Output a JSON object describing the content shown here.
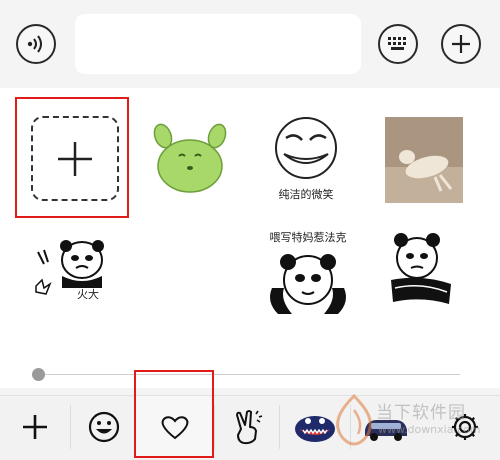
{
  "input_bar": {
    "voice_icon": "voice-waves-icon",
    "message_value": "",
    "keyboard_icon": "keyboard-icon",
    "add_icon": "plus-icon"
  },
  "sticker_panel": {
    "add_tile_icon": "plus-icon",
    "stickers": [
      {
        "icon": "green-blob-sticker",
        "caption": ""
      },
      {
        "icon": "grin-face-sticker",
        "caption": "纯洁的微笑"
      },
      {
        "icon": "dog-photo-sticker",
        "caption": ""
      },
      {
        "icon": "panda-meme-sticker",
        "caption": "火大"
      },
      {
        "icon": "panda-meme-sticker",
        "caption": "喂写特妈惹法克"
      },
      {
        "icon": "panda-meme-sticker",
        "caption": ""
      }
    ],
    "scroll_position": 0
  },
  "bottom_tabs": [
    {
      "icon": "plus-icon"
    },
    {
      "icon": "smiley-icon"
    },
    {
      "icon": "heart-icon",
      "selected": true
    },
    {
      "icon": "victory-hand-icon"
    },
    {
      "icon": "monster-sticker-icon"
    },
    {
      "icon": "car-sticker-icon"
    },
    {
      "icon": "gear-icon"
    }
  ],
  "watermark": {
    "title": "当下软件园",
    "url": "www.downxia.com"
  },
  "colors": {
    "highlight": "#e11a1a",
    "panel_bg": "#ffffff",
    "bar_bg": "#f4f4f4"
  }
}
